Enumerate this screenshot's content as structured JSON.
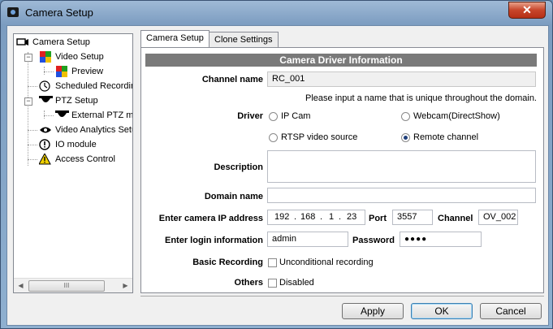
{
  "window": {
    "title": "Camera Setup",
    "close_glyph": "✕"
  },
  "tree": {
    "items": [
      {
        "label": "Camera Setup",
        "icon": "camera-icon"
      },
      {
        "label": "Video Setup",
        "icon": "video-setup-icon"
      },
      {
        "label": "Preview",
        "icon": "preview-icon"
      },
      {
        "label": "Scheduled Recording",
        "icon": "clock-icon"
      },
      {
        "label": "PTZ Setup",
        "icon": "ptz-icon"
      },
      {
        "label": "External PTZ moc",
        "icon": "ptz-camera-icon"
      },
      {
        "label": "Video Analytics Setup",
        "icon": "eye-icon"
      },
      {
        "label": "IO module",
        "icon": "io-icon"
      },
      {
        "label": "Access Control",
        "icon": "warning-icon"
      }
    ],
    "scroll_left": "◀",
    "scroll_right": "▶",
    "thumb_grip": "III"
  },
  "tabs": [
    {
      "label": "Camera Setup",
      "active": true
    },
    {
      "label": "Clone Settings",
      "active": false
    }
  ],
  "form": {
    "section_title": "Camera Driver Information",
    "channel_name_label": "Channel name",
    "channel_name_value": "RC_001",
    "hint": "Please input a name that is unique throughout the domain.",
    "driver_label": "Driver",
    "driver_options": [
      "IP Cam",
      "Webcam(DirectShow)",
      "RTSP video source",
      "Remote channel"
    ],
    "driver_selected": "Remote channel",
    "description_label": "Description",
    "description_value": "",
    "domain_label": "Domain name",
    "domain_value": "",
    "ip_label": "Enter camera IP address",
    "ip_parts": [
      "192",
      "168",
      "1",
      "23"
    ],
    "port_label": "Port",
    "port_value": "3557",
    "channel_label": "Channel",
    "channel_value": "OV_002",
    "login_label": "Enter login information",
    "login_value": "admin",
    "password_label": "Password",
    "password_value": "●●●●",
    "basic_rec_label": "Basic Recording",
    "basic_rec_option": "Unconditional recording",
    "others_label": "Others",
    "others_option": "Disabled"
  },
  "buttons": {
    "apply": "Apply",
    "ok": "OK",
    "cancel": "Cancel"
  }
}
